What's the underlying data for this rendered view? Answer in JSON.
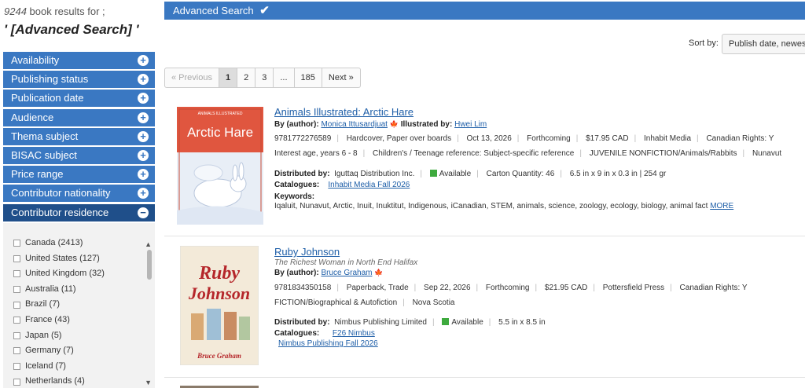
{
  "results_header": {
    "count": "9244",
    "count_suffix": "book results for ;",
    "query": "' [Advanced Search] '"
  },
  "facets": [
    {
      "label": "Availability",
      "state": "+"
    },
    {
      "label": "Publishing status",
      "state": "+"
    },
    {
      "label": "Publication date",
      "state": "+"
    },
    {
      "label": "Audience",
      "state": "+"
    },
    {
      "label": "Thema subject",
      "state": "+"
    },
    {
      "label": "BISAC subject",
      "state": "+"
    },
    {
      "label": "Price range",
      "state": "+"
    },
    {
      "label": "Contributor nationality",
      "state": "+"
    },
    {
      "label": "Contributor residence",
      "state": "−"
    }
  ],
  "residence_options": [
    "Canada (2413)",
    "United States (127)",
    "United Kingdom (32)",
    "Australia (11)",
    "Brazil (7)",
    "France (43)",
    "Japan (5)",
    "Germany (7)",
    "Iceland (7)",
    "Netherlands (4)"
  ],
  "advanced_search_label": "Advanced Search",
  "sort": {
    "label": "Sort by:",
    "value": "Publish date, newest to oldest"
  },
  "pagination": [
    "« Previous",
    "1",
    "2",
    "3",
    "...",
    "185",
    "Next »"
  ],
  "results": [
    {
      "title": "Animals Illustrated: Arctic Hare",
      "author_label": "By (author):",
      "author": "Monica Ittusardjuat",
      "illustrator_label": "Illustrated by:",
      "illustrator": "Hwei Lim",
      "meta1": [
        "9781772276589",
        "Hardcover, Paper over boards",
        "Oct 13, 2026",
        "Forthcoming",
        "$17.95 CAD",
        "Inhabit Media",
        "Canadian Rights: Y"
      ],
      "meta2": [
        "Interest age, years 6 - 8",
        "Children's / Teenage reference: Subject-specific reference",
        "JUVENILE NONFICTION/Animals/Rabbits",
        "Nunavut"
      ],
      "distributed_label": "Distributed by:",
      "distributor": "Iguttaq Distribution Inc.",
      "availability": "Available",
      "dist_extra": [
        "Carton Quantity: 46",
        "6.5 in x 9 in x 0.3 in | 254 gr"
      ],
      "catalogues_label": "Catalogues:",
      "catalogues": [
        "Inhabit Media Fall 2026"
      ],
      "keywords_label": "Keywords:",
      "keywords": "Iqaluit, Nunavut, Arctic, Inuit, Inuktitut, Indigenous, iCanadian, STEM, animals, science, zoology, ecology, biology, animal fact",
      "more": "MORE",
      "cover_series": "ANIMALS ILLUSTRATED",
      "cover_title": "Arctic Hare"
    },
    {
      "title": "Ruby Johnson",
      "subtitle": "The Richest Woman in North End Halifax",
      "author_label": "By (author):",
      "author": "Bruce Graham",
      "meta1": [
        "9781834350158",
        "Paperback, Trade",
        "Sep 22, 2026",
        "Forthcoming",
        "$21.95 CAD",
        "Pottersfield Press",
        "Canadian Rights: Y"
      ],
      "meta2": [
        "FICTION/Biographical & Autofiction",
        "Nova Scotia"
      ],
      "distributed_label": "Distributed by:",
      "distributor": "Nimbus Publishing Limited",
      "availability": "Available",
      "dist_extra": [
        "5.5 in x 8.5 in"
      ],
      "catalogues_label": "Catalogues:",
      "catalogues": [
        "F26 Nimbus",
        "Nimbus Publishing Fall 2026"
      ],
      "cover_title_1": "Ruby",
      "cover_title_2": "Johnson",
      "cover_tagline": "The Richest Woman in North End Halifax",
      "cover_author": "Bruce Graham"
    }
  ],
  "colors": {
    "accent": "#3a78c2",
    "active_facet": "#1f4f8a",
    "link": "#1f5fa8",
    "available": "#3eaa3e"
  }
}
